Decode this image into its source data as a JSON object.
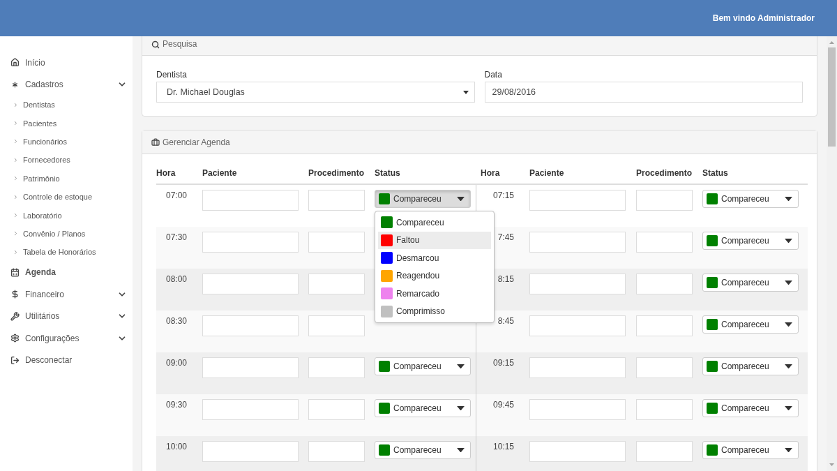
{
  "header": {
    "welcome": "Bem vindo Administrador"
  },
  "sidebar": {
    "items": [
      {
        "label": "Início",
        "active": false
      },
      {
        "label": "Cadastros",
        "active": false,
        "expandable": true,
        "children": [
          {
            "label": "Dentistas"
          },
          {
            "label": "Pacientes"
          },
          {
            "label": "Funcionários"
          },
          {
            "label": "Fornecedores"
          },
          {
            "label": "Patrimônio"
          },
          {
            "label": "Controle de estoque"
          },
          {
            "label": "Laboratório"
          },
          {
            "label": "Convênio / Planos"
          },
          {
            "label": "Tabela de Honorários"
          }
        ]
      },
      {
        "label": "Agenda",
        "active": true
      },
      {
        "label": "Financeiro",
        "active": false,
        "expandable": true
      },
      {
        "label": "Utilitários",
        "active": false,
        "expandable": true
      },
      {
        "label": "Configurações",
        "active": false,
        "expandable": true
      },
      {
        "label": "Desconectar",
        "active": false
      }
    ]
  },
  "search": {
    "title": "Pesquisa",
    "dentist": {
      "label": "Dentista",
      "value": "Dr. Michael Douglas"
    },
    "date": {
      "label": "Data",
      "value": "29/08/2016"
    }
  },
  "agenda": {
    "title": "Gerenciar Agenda",
    "columns": [
      "Hora",
      "Paciente",
      "Procedimento",
      "Status",
      "Hora",
      "Paciente",
      "Procedimento",
      "Status"
    ],
    "rows": [
      {
        "left": {
          "time": "07:00",
          "status": {
            "label": "Compareceu",
            "color": "#008000",
            "open": true
          }
        },
        "right": {
          "time": "07:15",
          "status": {
            "label": "Compareceu",
            "color": "#008000",
            "open": false
          }
        }
      },
      {
        "left": {
          "time": "07:30"
        },
        "right": {
          "time": "7:45",
          "status": {
            "label": "Compareceu",
            "color": "#008000",
            "open": false
          }
        }
      },
      {
        "left": {
          "time": "08:00"
        },
        "right": {
          "time": "8:15",
          "status": {
            "label": "Compareceu",
            "color": "#008000",
            "open": false
          }
        }
      },
      {
        "left": {
          "time": "08:30"
        },
        "right": {
          "time": "8:45",
          "status": {
            "label": "Compareceu",
            "color": "#008000",
            "open": false
          }
        }
      },
      {
        "left": {
          "time": "09:00",
          "status": {
            "label": "Compareceu",
            "color": "#008000",
            "open": false
          }
        },
        "right": {
          "time": "09:15",
          "status": {
            "label": "Compareceu",
            "color": "#008000",
            "open": false
          }
        }
      },
      {
        "left": {
          "time": "09:30",
          "status": {
            "label": "Compareceu",
            "color": "#008000",
            "open": false
          }
        },
        "right": {
          "time": "09:45",
          "status": {
            "label": "Compareceu",
            "color": "#008000",
            "open": false
          }
        }
      },
      {
        "left": {
          "time": "10:00",
          "status": {
            "label": "Compareceu",
            "color": "#008000",
            "open": false
          }
        },
        "right": {
          "time": "10:15",
          "status": {
            "label": "Compareceu",
            "color": "#008000",
            "open": false
          }
        }
      }
    ],
    "status_menu": [
      {
        "label": "Compareceu",
        "color": "#008000",
        "highlighted": false
      },
      {
        "label": "Faltou",
        "color": "#ff0000",
        "highlighted": true
      },
      {
        "label": "Desmarcou",
        "color": "#0000ff",
        "highlighted": false
      },
      {
        "label": "Reagendou",
        "color": "#ffa500",
        "highlighted": false
      },
      {
        "label": "Remarcado",
        "color": "#ee82ee",
        "highlighted": false
      },
      {
        "label": "Comprimisso",
        "color": "#c0c0c0",
        "highlighted": false
      }
    ]
  }
}
